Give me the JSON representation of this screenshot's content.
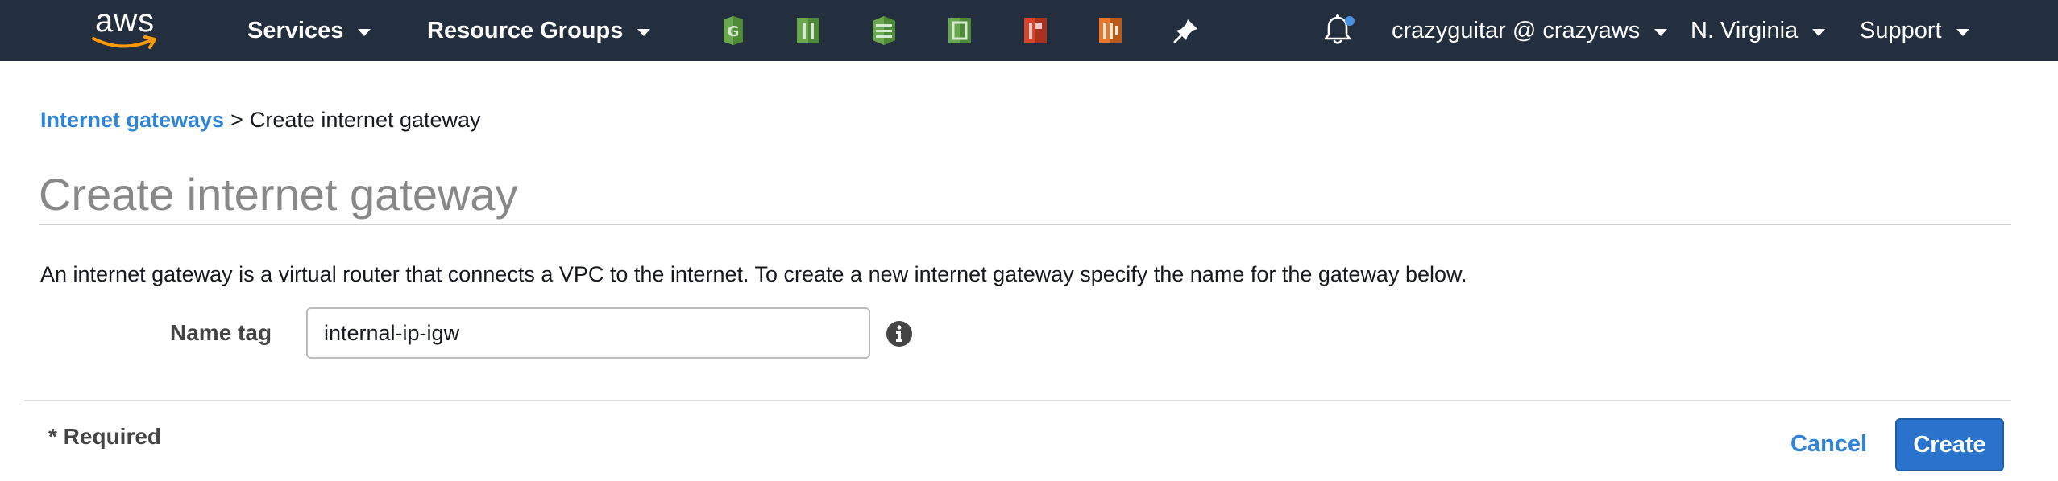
{
  "nav": {
    "logo_text": "aws",
    "services_label": "Services",
    "resource_groups_label": "Resource Groups",
    "service_shortcuts": [
      {
        "icon": "cloudfront-icon",
        "color": "#6aa84f"
      },
      {
        "icon": "ec2-icon",
        "color": "#6aa84f"
      },
      {
        "icon": "dynamodb-icon",
        "color": "#6aa84f"
      },
      {
        "icon": "lightsail-icon",
        "color": "#6aa84f"
      },
      {
        "icon": "s3-red-icon",
        "color": "#d9442b"
      },
      {
        "icon": "ecs-icon",
        "color": "#e8762b"
      },
      {
        "icon": "pin-icon",
        "color": "#ffffff"
      }
    ],
    "notification_icon": "bell-icon",
    "notification_dot_color": "#4a90e2",
    "account_label": "crazyguitar @ crazyaws",
    "region_label": "N. Virginia",
    "support_label": "Support"
  },
  "breadcrumb": {
    "parent_label": "Internet gateways",
    "separator": ">",
    "current_label": "Create internet gateway"
  },
  "page": {
    "title": "Create internet gateway",
    "description": "An internet gateway is a virtual router that connects a VPC to the internet. To create a new internet gateway specify the name for the gateway below."
  },
  "form": {
    "name_tag_label": "Name tag",
    "name_tag_value": "internal-ip-igw",
    "info_icon": "info-icon"
  },
  "footer": {
    "required_note": "* Required",
    "cancel_label": "Cancel",
    "create_label": "Create"
  },
  "colors": {
    "nav_background": "#232f3e",
    "link": "#2e84d6",
    "primary_button": "#2a73cc"
  }
}
